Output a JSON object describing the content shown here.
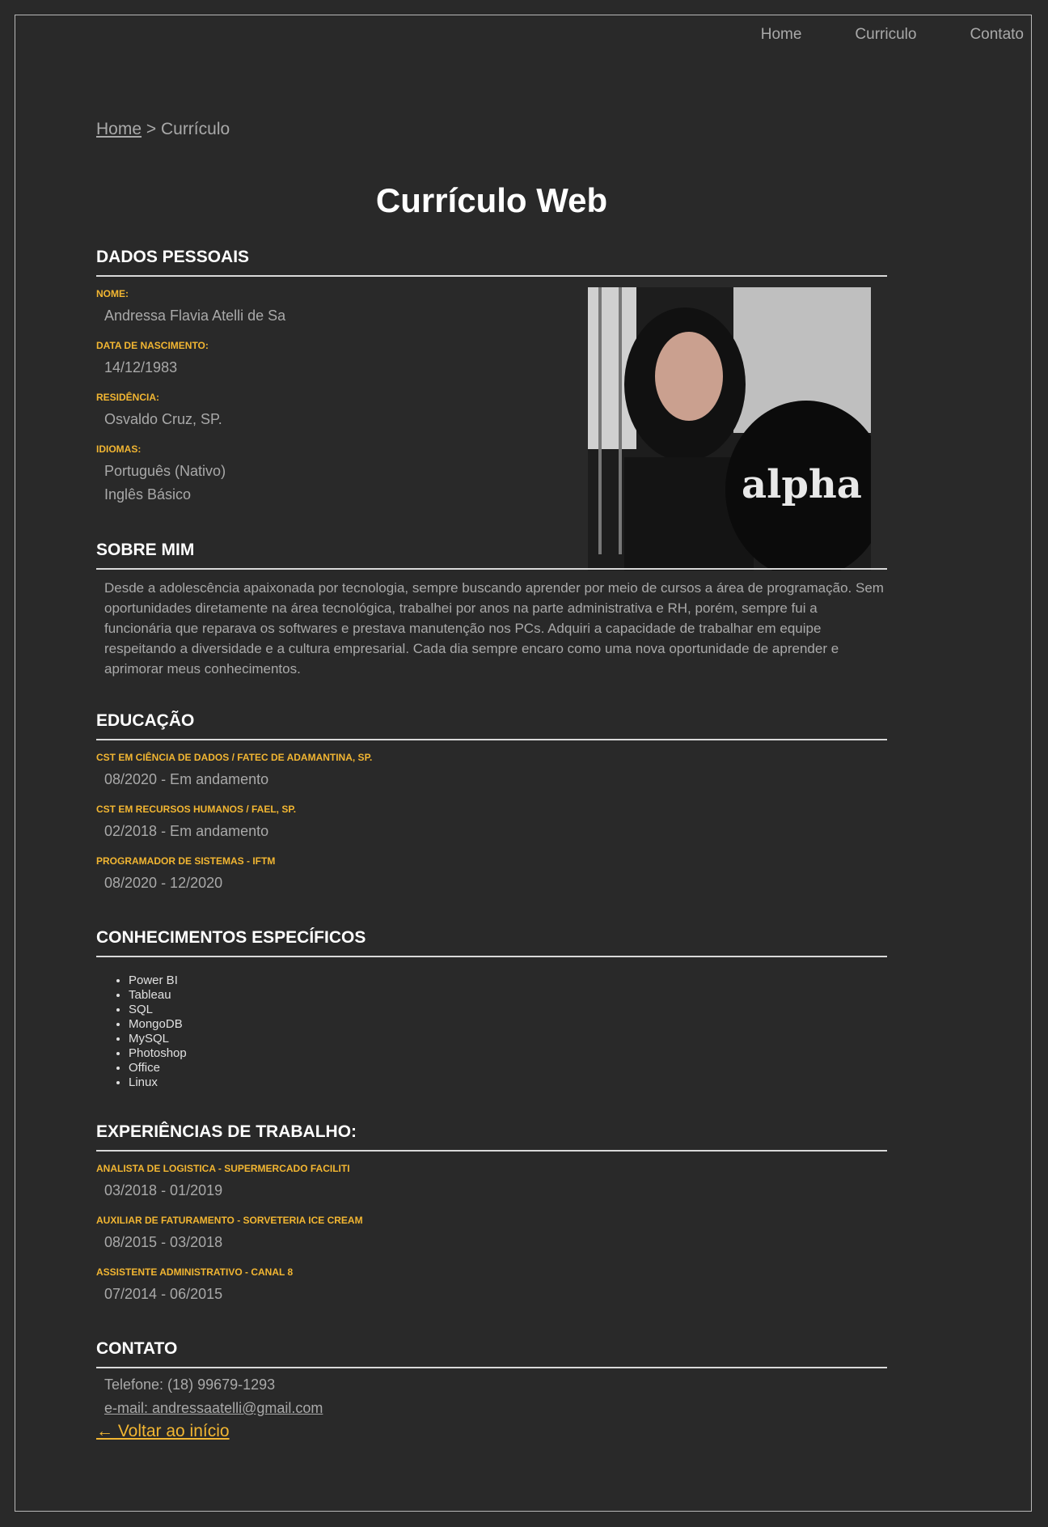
{
  "nav": [
    "Home",
    "Curriculo",
    "Contato"
  ],
  "breadcrumb": {
    "home": "Home",
    "sep": " > ",
    "current": "Currículo"
  },
  "title": "Currículo Web",
  "personal": {
    "heading": "DADOS PESSOAIS",
    "name_label": "NOME:",
    "name": "Andressa Flavia Atelli de Sa",
    "birth_label": "DATA DE NASCIMENTO:",
    "birth": "14/12/1983",
    "residence_label": "RESIDÊNCIA:",
    "residence": "Osvaldo Cruz, SP.",
    "lang_label": "IDIOMAS:",
    "lang1": "Português (Nativo)",
    "lang2": "Inglês Básico"
  },
  "about": {
    "heading": "SOBRE MIM",
    "text": "Desde a adolescência apaixonada por tecnologia, sempre buscando aprender por meio de cursos a área de programação. Sem oportunidades diretamente na área tecnológica, trabalhei por anos na parte administrativa e RH, porém, sempre fui a funcionária que reparava os softwares e prestava manutenção nos PCs. Adquiri a capacidade de trabalhar em equipe respeitando a diversidade e a cultura empresarial. Cada dia sempre encaro como uma nova oportunidade de aprender e aprimorar meus conhecimentos."
  },
  "education": {
    "heading": "EDUCAÇÃO",
    "items": [
      {
        "label": "CST EM CIÊNCIA DE DADOS / FATEC DE ADAMANTINA, SP.",
        "value": "08/2020 - Em andamento"
      },
      {
        "label": "CST EM RECURSOS HUMANOS / FAEL, SP.",
        "value": "02/2018 - Em andamento"
      },
      {
        "label": "PROGRAMADOR DE SISTEMAS - IFTM",
        "value": "08/2020 - 12/2020"
      }
    ]
  },
  "skills": {
    "heading": "CONHECIMENTOS ESPECÍFICOS",
    "items": [
      "Power BI",
      "Tableau",
      "SQL",
      "MongoDB",
      "MySQL",
      "Photoshop",
      "Office",
      "Linux"
    ]
  },
  "work": {
    "heading": "EXPERIÊNCIAS DE TRABALHO:",
    "items": [
      {
        "label": "ANALISTA DE LOGISTICA - SUPERMERCADO FACILITI",
        "value": "03/2018 - 01/2019"
      },
      {
        "label": "AUXILIAR DE FATURAMENTO - SORVETERIA ICE CREAM",
        "value": "08/2015 - 03/2018"
      },
      {
        "label": "ASSISTENTE ADMINISTRATIVO - CANAL 8",
        "value": "07/2014 - 06/2015"
      }
    ]
  },
  "contact": {
    "heading": "CONTATO",
    "phone": "Telefone: (18) 99679-1293",
    "email": "e-mail: andressaatelli@gmail.com",
    "back": "← Voltar ao início"
  },
  "photo_text": "alpha"
}
